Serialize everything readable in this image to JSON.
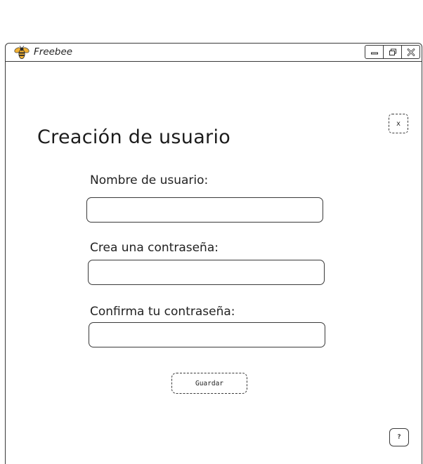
{
  "app": {
    "name": "Freebee",
    "logo_icon": "bee-icon"
  },
  "window_controls": {
    "minimize_icon": "minimize-icon",
    "maximize_icon": "maximize-icon",
    "close_icon": "close-icon"
  },
  "page": {
    "title": "Creación de usuario",
    "close_label": "x"
  },
  "form": {
    "username_label": "Nombre de usuario:",
    "username_value": "",
    "password_label": "Crea una contraseña:",
    "password_value": "",
    "confirm_label": "Confirma tu contraseña:",
    "confirm_value": "",
    "save_label": "Guardar"
  },
  "help": {
    "label": "?"
  },
  "colors": {
    "stroke": "#3a3a3a",
    "bee_yellow": "#f2b233",
    "background": "#ffffff"
  }
}
